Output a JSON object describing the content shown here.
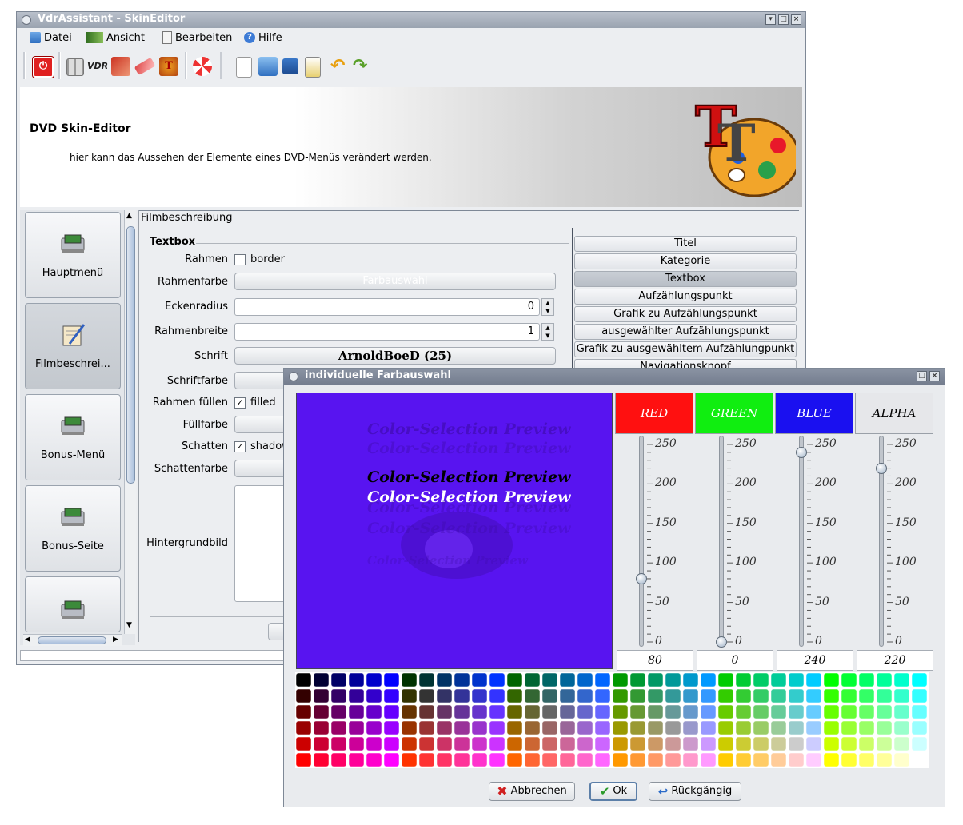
{
  "main_window": {
    "title": "VdrAssistant - SkinEditor",
    "menu": [
      "Datei",
      "Ansicht",
      "Bearbeiten",
      "Hilfe"
    ],
    "banner": {
      "title": "DVD Skin-Editor",
      "subtitle": "hier kann das Aussehen der Elemente eines DVD-Menüs verändert werden."
    },
    "nav_items": [
      "Hauptmenü",
      "Filmbeschrei...",
      "Bonus-Menü",
      "Bonus-Seite",
      ""
    ],
    "tab_label": "Filmbeschreibung",
    "section_title": "Textbox",
    "form": {
      "rahmen_label": "Rahmen",
      "rahmen_checkbox": "border",
      "rahmenfarbe_label": "Rahmenfarbe",
      "rahmenfarbe_button": "Farbauswahl",
      "eckenradius_label": "Eckenradius",
      "eckenradius_value": "0",
      "rahmenbreite_label": "Rahmenbreite",
      "rahmenbreite_value": "1",
      "schrift_label": "Schrift",
      "schrift_value": "ArnoldBoeD (25)",
      "schriftfarbe_label": "Schriftfarbe",
      "rahmen_fuellen_label": "Rahmen füllen",
      "rahmen_fuellen_checkbox": "filled",
      "fuellfarbe_label": "Füllfarbe",
      "schatten_label": "Schatten",
      "schatten_checkbox": "shadow",
      "schattenfarbe_label": "Schattenfarbe",
      "hintergrundbild_label": "Hintergrundbild"
    },
    "element_list": [
      "Titel",
      "Kategorie",
      "Textbox",
      "Aufzählungspunkt",
      "Grafik zu Aufzählungspunkt",
      "ausgewählter Aufzählungspunkt",
      "Grafik zu ausgewähltem Aufzählungpunkt",
      "Navigationsknopf"
    ],
    "selected_element": "Textbox"
  },
  "dialog": {
    "title": "individuelle Farbauswahl",
    "preview_text": "Color-Selection Preview",
    "channels": [
      {
        "name": "RED",
        "value": 80,
        "header_color": "#ff1010",
        "text_color": "#ffffff"
      },
      {
        "name": "GREEN",
        "value": 0,
        "header_color": "#10ee10",
        "text_color": "#ffffff"
      },
      {
        "name": "BLUE",
        "value": 240,
        "header_color": "#1a10f0",
        "text_color": "#ffffff"
      },
      {
        "name": "ALPHA",
        "value": 220,
        "header_color": "#e6e7ea",
        "text_color": "#000000"
      }
    ],
    "scale_labels": [
      "250",
      "200",
      "150",
      "100",
      "50",
      "0"
    ],
    "scale_max": 255,
    "buttons": {
      "cancel": "Abbrechen",
      "ok": "Ok",
      "undo": "Rückgängig"
    }
  },
  "colors": {
    "preview_bg": "#5814f0"
  }
}
